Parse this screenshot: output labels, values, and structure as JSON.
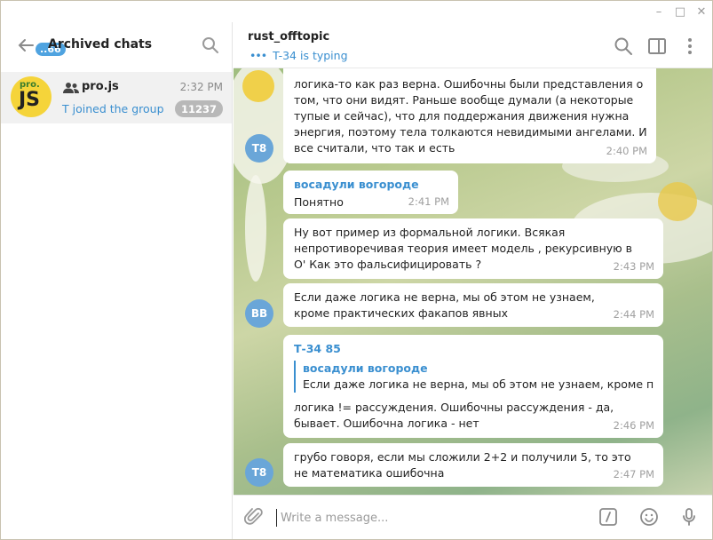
{
  "window": {
    "minimize": "–",
    "maximize": "□",
    "close": "✕"
  },
  "left": {
    "badge": "..66",
    "title": "Archived chats",
    "chat": {
      "avatar_small": "pro.",
      "avatar_big": "JS",
      "name": "pro.js",
      "time": "2:32 PM",
      "preview": "T joined the group",
      "unread": "11237"
    }
  },
  "header": {
    "title": "rust_offtopic",
    "status": "T-34 is typing",
    "status_dots": "•••"
  },
  "messages": [
    {
      "text": "логика-то как раз верна. Ошибочны были представления о том, что они видят. Раньше вообще думали (а некоторые тупые и сейчас), что для поддержания движения нужна энергия, поэтому тела толкаются невидимыми ангелами. И все считали, что так и есть",
      "time": "2:40 PM",
      "avatar": "T8"
    },
    {
      "sender": "восадули вогороде",
      "text": "Понятно",
      "time": "2:41 PM"
    },
    {
      "text": "Ну вот пример из формальной логики. Всякая непротиворечивая теория имеет модель , рекурсивную в O' Как это фальсифицировать ?",
      "time": "2:43 PM"
    },
    {
      "text": "Если даже логика не верна, мы об этом не узнаем, кроме практических факапов явных",
      "time": "2:44 PM",
      "avatar": "BB"
    },
    {
      "sender": "Т-34 85",
      "quote_sender": "восадули вогороде",
      "quote_text": "Если даже логика не верна, мы об этом не узнаем, кроме пра...",
      "text": "логика != рассуждения. Ошибочны рассуждения - да, бывает. Ошибочна логика - нет",
      "time": "2:46 PM"
    },
    {
      "text": "грубо говоря, если мы сложили 2+2 и получили 5, то это не математика ошибочна",
      "time": "2:47 PM",
      "avatar": "T8"
    }
  ],
  "composer": {
    "placeholder": "Write a message..."
  }
}
